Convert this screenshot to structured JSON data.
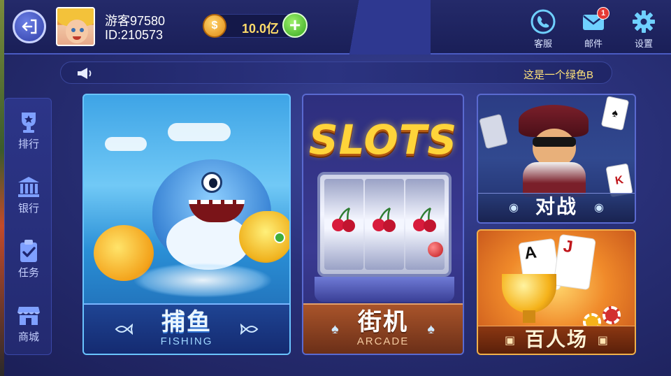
{
  "header": {
    "username": "游客97580",
    "user_id": "ID:210573",
    "coins": "10.0亿",
    "coin_symbol": "$",
    "add_symbol": "+",
    "actions": [
      {
        "label": "客服",
        "icon": "customer-service-icon"
      },
      {
        "label": "邮件",
        "icon": "mail-icon",
        "badge": "1"
      },
      {
        "label": "设置",
        "icon": "gear-icon"
      }
    ]
  },
  "notice": {
    "text": "这是一个绿色B",
    "icon": "megaphone-icon"
  },
  "sidebar": {
    "items": [
      {
        "label": "排行",
        "icon": "trophy-star-icon"
      },
      {
        "label": "银行",
        "icon": "bank-icon"
      },
      {
        "label": "任务",
        "icon": "clipboard-check-icon"
      },
      {
        "label": "商城",
        "icon": "store-icon"
      }
    ]
  },
  "games": {
    "fishing": {
      "title_cn": "捕鱼",
      "title_en": "FISHING",
      "deco": "fish-icon"
    },
    "slots": {
      "logo": "SLOTS",
      "title_cn": "街机",
      "title_en": "ARCADE",
      "deco": "♠"
    },
    "battle": {
      "title_cn": "对战",
      "deco": "dot-icon",
      "card1": "♠",
      "card2": "K"
    },
    "baccarat": {
      "title_cn": "百人场",
      "deco": "card-icon",
      "card1": "A",
      "card2": "J"
    }
  },
  "colors": {
    "accent_gold": "#ffd43a",
    "coin_text": "#ffdc6a",
    "notice_text": "#ffe27a",
    "badge_red": "#e53935",
    "add_green": "#35a820"
  }
}
